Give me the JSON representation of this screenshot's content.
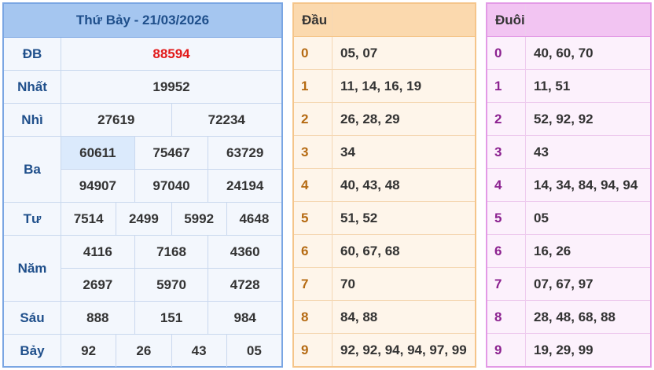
{
  "results": {
    "title": "Thứ Bảy - 21/03/2026",
    "prizes": [
      {
        "label": "ĐB",
        "lines": [
          [
            "88594"
          ]
        ]
      },
      {
        "label": "Nhất",
        "lines": [
          [
            "19952"
          ]
        ]
      },
      {
        "label": "Nhì",
        "lines": [
          [
            "27619",
            "72234"
          ]
        ]
      },
      {
        "label": "Ba",
        "lines": [
          [
            "60611",
            "75467",
            "63729"
          ],
          [
            "94907",
            "97040",
            "24194"
          ]
        ]
      },
      {
        "label": "Tư",
        "lines": [
          [
            "7514",
            "2499",
            "5992",
            "4648"
          ]
        ]
      },
      {
        "label": "Năm",
        "lines": [
          [
            "4116",
            "7168",
            "4360"
          ],
          [
            "2697",
            "5970",
            "4728"
          ]
        ]
      },
      {
        "label": "Sáu",
        "lines": [
          [
            "888",
            "151",
            "984"
          ]
        ]
      },
      {
        "label": "Bảy",
        "lines": [
          [
            "92",
            "26",
            "43",
            "05"
          ]
        ]
      }
    ],
    "special_color": "#e21a1a",
    "highlight_color": "#dbeafc"
  },
  "dau": {
    "header": "Đầu",
    "rows": [
      {
        "key": "0",
        "values": "05, 07"
      },
      {
        "key": "1",
        "values": "11, 14, 16, 19"
      },
      {
        "key": "2",
        "values": "26, 28, 29"
      },
      {
        "key": "3",
        "values": "34"
      },
      {
        "key": "4",
        "values": "40, 43, 48"
      },
      {
        "key": "5",
        "values": "51, 52"
      },
      {
        "key": "6",
        "values": "60, 67, 68"
      },
      {
        "key": "7",
        "values": "70"
      },
      {
        "key": "8",
        "values": "84, 88"
      },
      {
        "key": "9",
        "values": "92, 92, 94, 94, 97, 99"
      }
    ]
  },
  "duoi": {
    "header": "Đuôi",
    "rows": [
      {
        "key": "0",
        "values": "40, 60, 70"
      },
      {
        "key": "1",
        "values": "11, 51"
      },
      {
        "key": "2",
        "values": "52, 92, 92"
      },
      {
        "key": "3",
        "values": "43"
      },
      {
        "key": "4",
        "values": "14, 34, 84, 94, 94"
      },
      {
        "key": "5",
        "values": "05"
      },
      {
        "key": "6",
        "values": "16, 26"
      },
      {
        "key": "7",
        "values": "07, 67, 97"
      },
      {
        "key": "8",
        "values": "28, 48, 68, 88"
      },
      {
        "key": "9",
        "values": "19, 29, 99"
      }
    ]
  }
}
